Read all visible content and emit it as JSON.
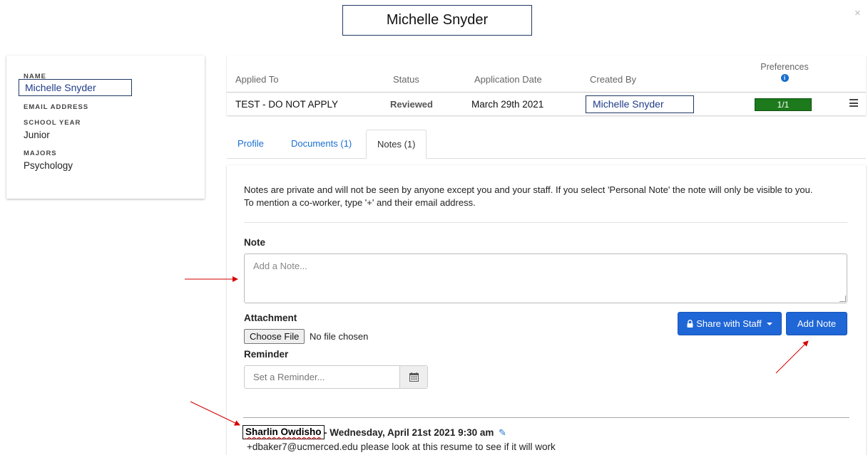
{
  "modal": {
    "title": "Michelle Snyder",
    "close_symbol": "×"
  },
  "student": {
    "name_label": "NAME",
    "name": "Michelle Snyder",
    "email_label": "EMAIL ADDRESS",
    "school_year_label": "SCHOOL YEAR",
    "school_year": "Junior",
    "majors_label": "MAJORS",
    "majors": "Psychology"
  },
  "application": {
    "headers": {
      "applied_to": "Applied To",
      "status": "Status",
      "application_date": "Application Date",
      "created_by": "Created By",
      "preferences": "Preferences"
    },
    "row": {
      "applied_to": "TEST - DO NOT APPLY",
      "status": "Reviewed",
      "application_date": "March 29th 2021",
      "created_by": "Michelle Snyder",
      "preferences": "1/1"
    }
  },
  "tabs": [
    {
      "label": "Profile",
      "active": false
    },
    {
      "label": "Documents (1)",
      "active": false
    },
    {
      "label": "Notes (1)",
      "active": true
    }
  ],
  "notes_panel": {
    "intro_line1": "Notes are private and will not be seen by anyone except you and your staff. If you select 'Personal Note' the note will only be visible to you.",
    "intro_line2": "To mention a co-worker, type '+' and their email address.",
    "note_label": "Note",
    "note_placeholder": "Add a Note...",
    "attachment_label": "Attachment",
    "choose_file_label": "Choose File",
    "no_file_text": "No file chosen",
    "reminder_label": "Reminder",
    "reminder_placeholder": "Set a Reminder...",
    "share_button_label": "Share with Staff",
    "add_note_button_label": "Add Note"
  },
  "existing_note": {
    "author": "Sharlin Owdisho",
    "meta": "- Wednesday, April 21st 2021 9:30 am",
    "body": "+dbaker7@ucmerced.edu please look at this resume to see if it will work"
  },
  "colors": {
    "primary_button": "#1f66d6",
    "link": "#1a6fd0",
    "preference_bar": "#1c7a1c",
    "annotation_arrow": "#d40000"
  },
  "icons": {
    "close": "close-icon",
    "info": "info-icon",
    "menu": "hamburger-menu-icon",
    "lock": "lock-icon",
    "calendar": "calendar-icon",
    "edit": "pencil-icon"
  }
}
